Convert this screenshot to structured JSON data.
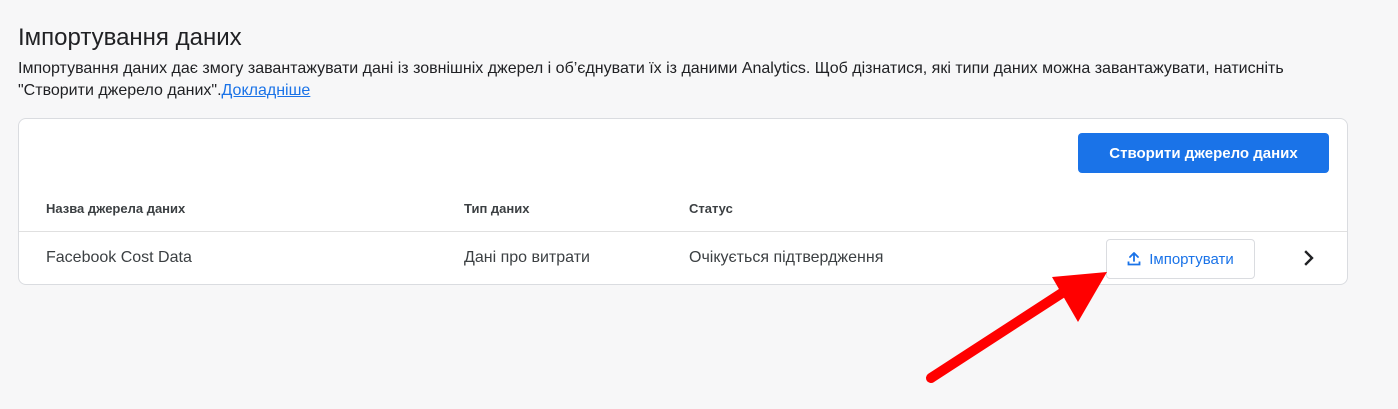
{
  "header": {
    "title": "Імпортування даних",
    "description": "Імпортування даних дає змогу завантажувати дані із зовнішніх джерел і об’єднувати їх із даними Analytics. Щоб дізнатися, які типи даних можна завантажувати, натисніть \"Створити джерело даних\".",
    "learn_more": "Докладніше"
  },
  "toolbar": {
    "create_label": "Створити джерело даних"
  },
  "table": {
    "columns": [
      "Назва джерела даних",
      "Тип даних",
      "Статус"
    ],
    "rows": [
      {
        "name": "Facebook Cost Data",
        "type": "Дані про витрати",
        "status": "Очікується підтвердження",
        "action_label": "Імпортувати"
      }
    ]
  },
  "colors": {
    "accent": "#1a73e8",
    "annotation_arrow": "#ff0000"
  },
  "icons": {
    "upload": "upload-icon",
    "chevron": "chevron-right-icon"
  }
}
